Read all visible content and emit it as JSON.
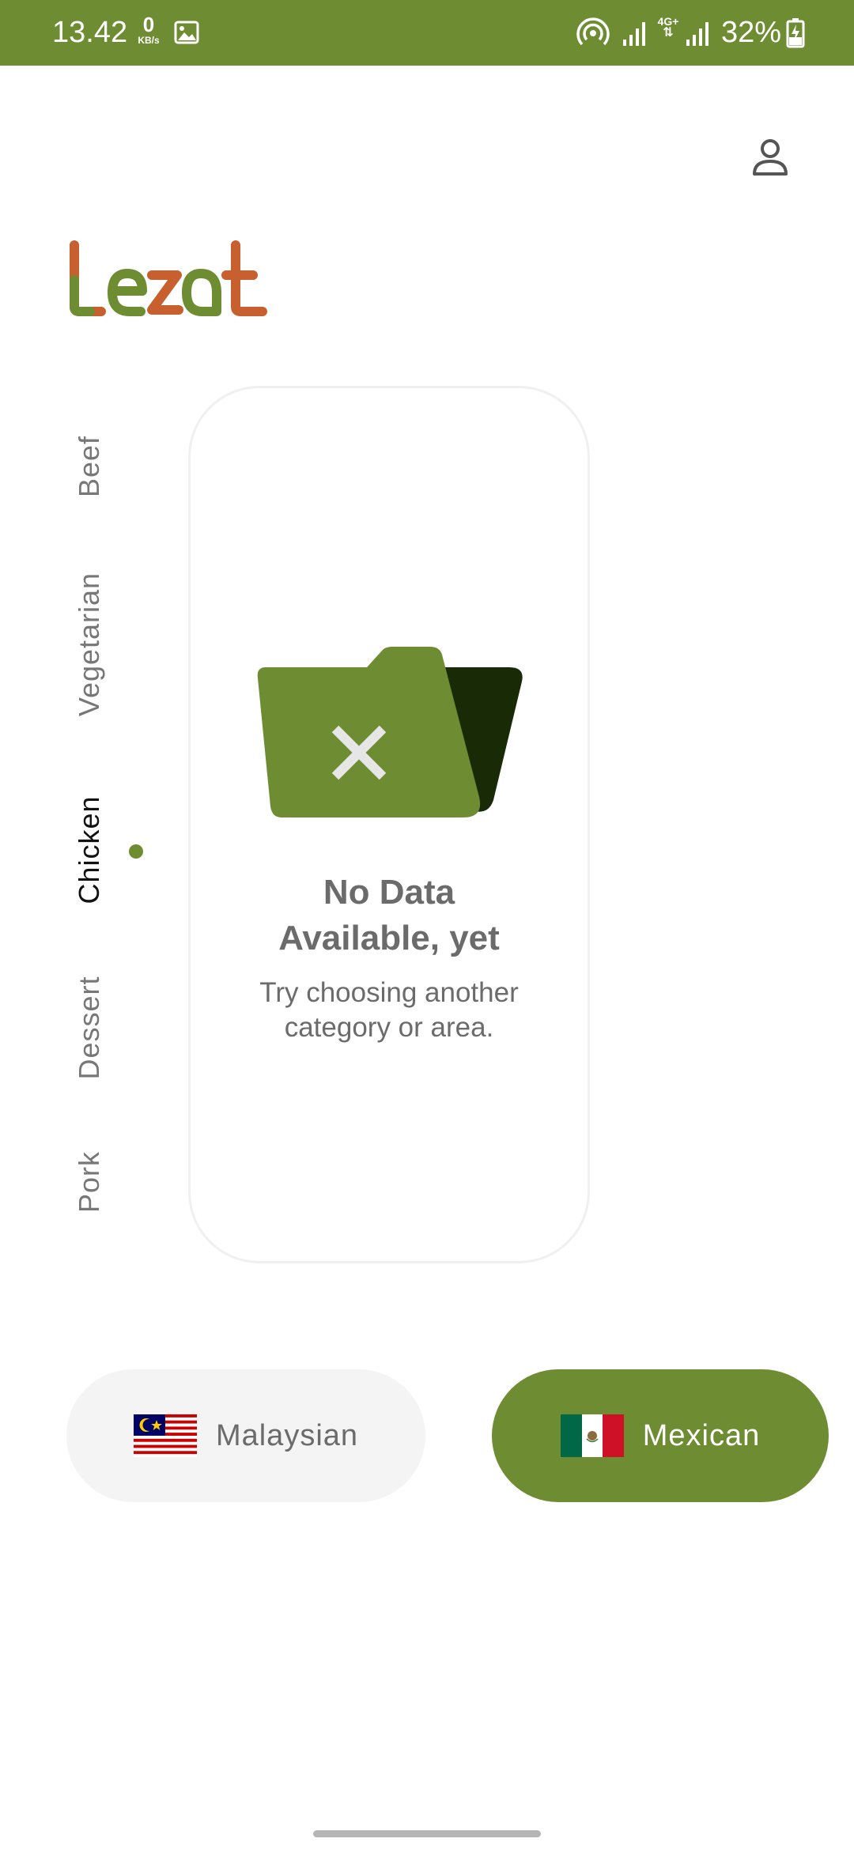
{
  "status_bar": {
    "time": "13.42",
    "net_speed_value": "0",
    "net_speed_unit": "KB/s",
    "network_type": "4G+",
    "battery": "32%"
  },
  "app": {
    "brand": "Lezat",
    "brand_colors": {
      "L": "#c75f2e",
      "e": "#6e8c31",
      "z": "#c75f2e",
      "a": "#6e8c31",
      "t": "#c75f2e"
    }
  },
  "categories": [
    {
      "label": "Beef",
      "active": false
    },
    {
      "label": "Vegetarian",
      "active": false
    },
    {
      "label": "Chicken",
      "active": true
    },
    {
      "label": "Dessert",
      "active": false
    },
    {
      "label": "Pork",
      "active": false
    }
  ],
  "empty_state": {
    "icon": "folder-x-icon",
    "title_line1": "No Data",
    "title_line2": "Available, yet",
    "subtitle_line1": "Try choosing another",
    "subtitle_line2": "category or area."
  },
  "areas": [
    {
      "label": "Malaysian",
      "flag": "malaysia-flag-icon",
      "selected": false
    },
    {
      "label": "Mexican",
      "flag": "mexico-flag-icon",
      "selected": true
    }
  ],
  "colors": {
    "primary": "#6e8c31",
    "accent": "#c75f2e",
    "folder_back": "#182a06"
  }
}
